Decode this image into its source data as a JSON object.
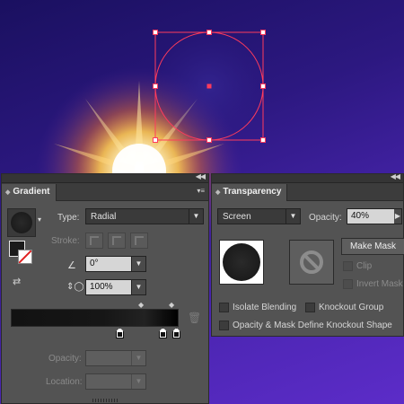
{
  "gradient_panel": {
    "tab_label": "Gradient",
    "type_label": "Type:",
    "type_value": "Radial",
    "stroke_label": "Stroke:",
    "angle_value": "0°",
    "aspect_value": "100%",
    "opacity_label": "Opacity:",
    "location_label": "Location:"
  },
  "transparency_panel": {
    "tab_label": "Transparency",
    "blend_mode": "Screen",
    "opacity_label": "Opacity:",
    "opacity_value": "40%",
    "make_mask_label": "Make Mask",
    "clip_label": "Clip",
    "invert_mask_label": "Invert Mask",
    "isolate_blending_label": "Isolate Blending",
    "knockout_group_label": "Knockout Group",
    "opacity_mask_knockout_label": "Opacity & Mask Define Knockout Shape"
  },
  "colors": {
    "panel_bg": "#535353",
    "selection": "#ff3b5c",
    "glow": "#ffd050"
  }
}
